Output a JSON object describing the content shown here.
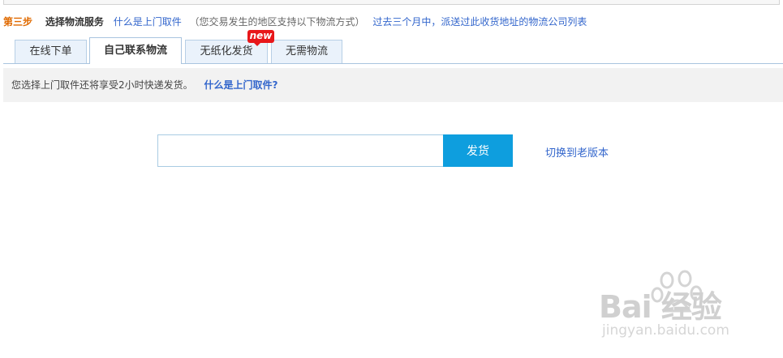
{
  "step": {
    "number": "第三步",
    "title": "选择物流服务",
    "pickup_link": "什么是上门取件",
    "note": "（您交易发生的地区支持以下物流方式）",
    "companies_link": "过去三个月中，派送过此收货地址的物流公司列表"
  },
  "tabs": [
    {
      "label": "在线下单"
    },
    {
      "label": "自己联系物流",
      "active": true
    },
    {
      "label": "无纸化发货",
      "badge": "new"
    },
    {
      "label": "无需物流"
    }
  ],
  "info": {
    "text": "您选择上门取件还将享受2小时快递发货。",
    "link": "什么是上门取件?"
  },
  "ship": {
    "input_value": "",
    "button_label": "发货",
    "switch_link": "切换到老版本"
  },
  "watermark": {
    "logo": "Bai 经验",
    "url": "jingyan.baidu.com"
  },
  "colors": {
    "step_number": "#e06a00",
    "link": "#3366cc",
    "button": "#0e9ede",
    "badge": "#e8171a",
    "tab_border": "#a9c4df"
  }
}
